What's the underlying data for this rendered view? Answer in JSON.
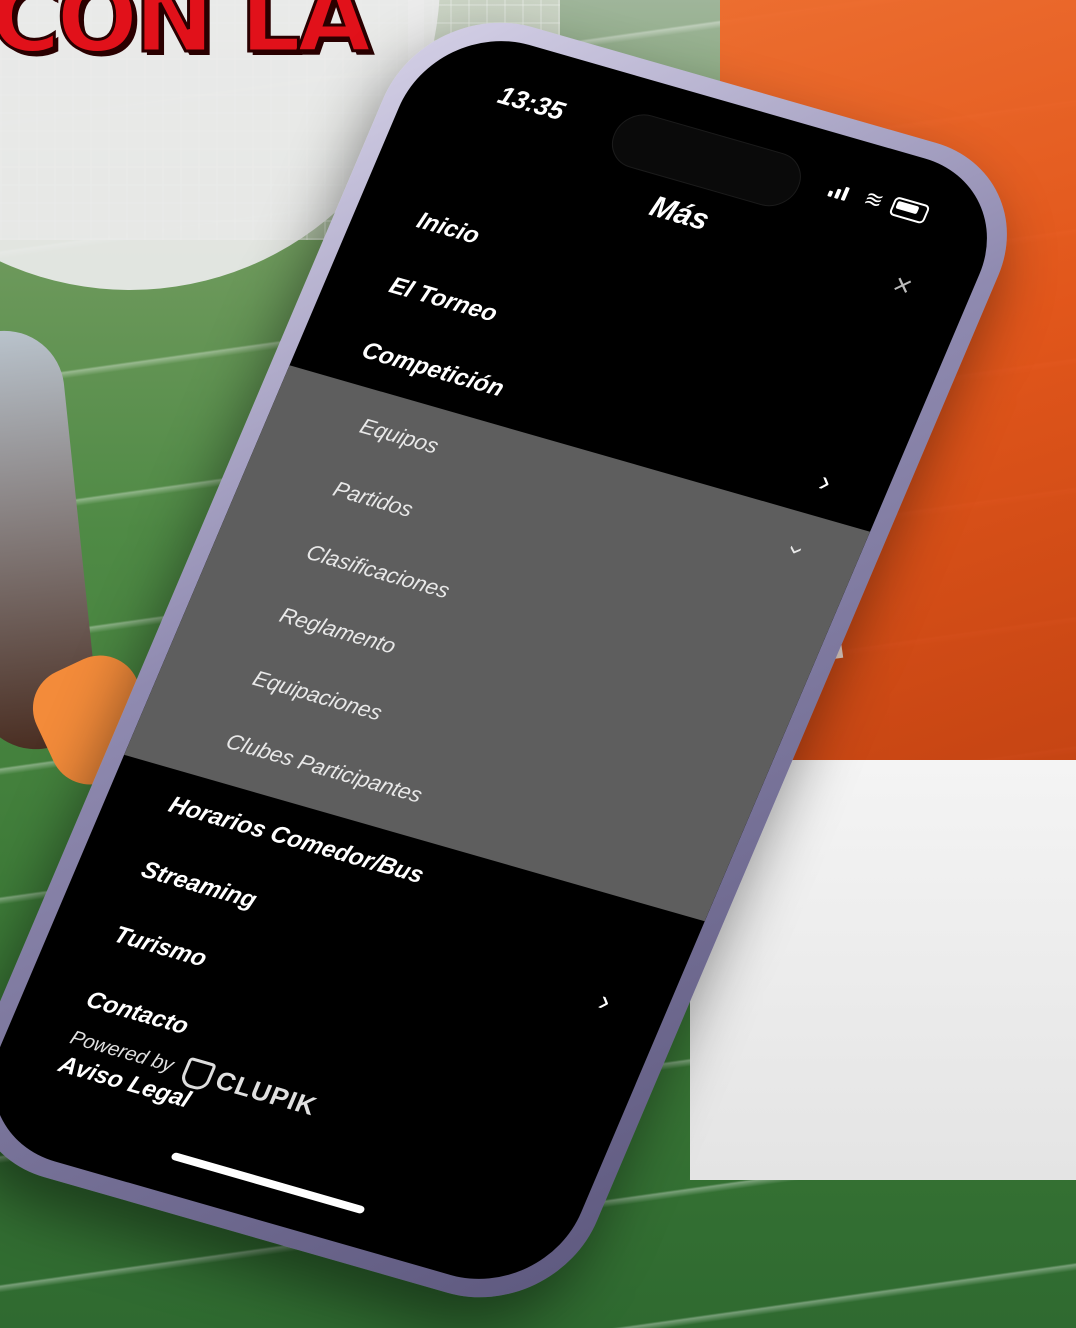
{
  "banner": {
    "headline": "CON LA"
  },
  "status_bar": {
    "time": "13:35"
  },
  "header": {
    "title": "Más",
    "close_icon": "close-icon"
  },
  "menu": {
    "items_top": [
      {
        "label": "Inicio"
      },
      {
        "label": "El Torneo"
      },
      {
        "label": "Competición",
        "icon": "chevron-right-icon"
      }
    ],
    "submenu": [
      {
        "label": "Equipos",
        "icon": "chevron-down-icon"
      },
      {
        "label": "Partidos"
      },
      {
        "label": "Clasificaciones"
      },
      {
        "label": "Reglamento"
      },
      {
        "label": "Equipaciones"
      },
      {
        "label": "Clubes Participantes"
      }
    ],
    "items_bottom": [
      {
        "label": "Horarios Comedor/Bus"
      },
      {
        "label": "Streaming",
        "icon": "chevron-right-icon"
      },
      {
        "label": "Turismo"
      },
      {
        "label": "Contacto"
      },
      {
        "label": "Aviso Legal"
      }
    ]
  },
  "footer": {
    "powered_by": "Powered by",
    "brand": "CLUPIK"
  },
  "colors": {
    "headline_red": "#e1111a",
    "screen_bg": "#000000",
    "submenu_bg": "#5e5e5e",
    "phone_frame": "#8f8ab0"
  }
}
